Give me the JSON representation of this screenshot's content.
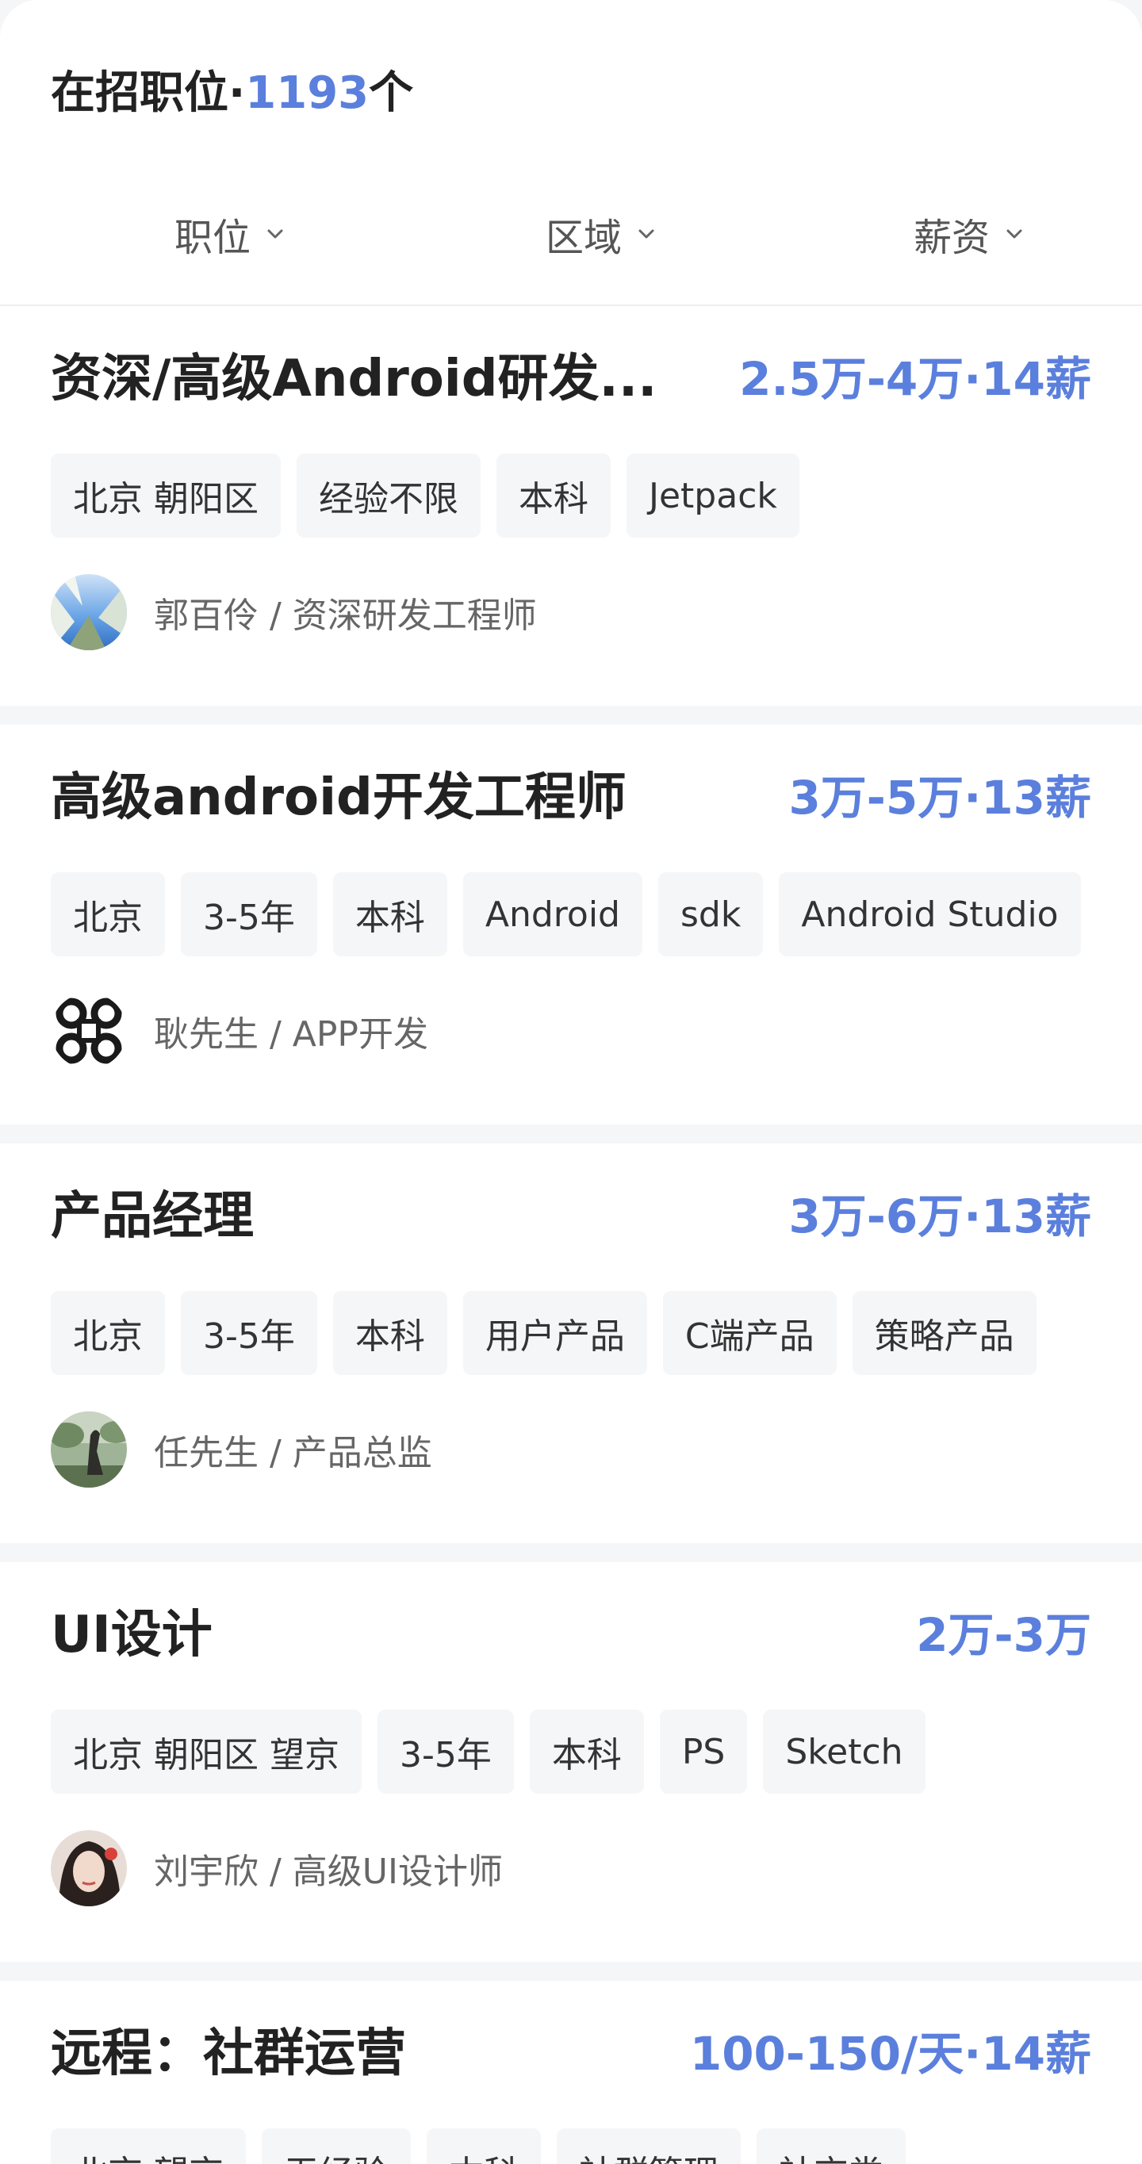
{
  "header": {
    "title_prefix": "在招职位·",
    "count": "1193",
    "title_suffix": "个"
  },
  "filters": [
    {
      "label": "职位",
      "icon": "chevron-down-icon"
    },
    {
      "label": "区域",
      "icon": "chevron-down-icon"
    },
    {
      "label": "薪资",
      "icon": "chevron-down-icon"
    }
  ],
  "jobs": [
    {
      "title": "资深/高级Android研发...",
      "salary": "2.5万-4万·14薪",
      "tags": [
        "北京 朝阳区",
        "经验不限",
        "本科",
        "Jetpack"
      ],
      "recruiter": "郭百伶 / 资深研发工程师",
      "avatar": "sky-photo-avatar"
    },
    {
      "title": "高级android开发工程师",
      "salary": "3万-5万·13薪",
      "tags": [
        "北京",
        "3-5年",
        "本科",
        "Android",
        "sdk",
        "Android Studio"
      ],
      "recruiter": "耿先生 / APP开发",
      "avatar": "knot-logo-avatar"
    },
    {
      "title": "产品经理",
      "salary": "3万-6万·13薪",
      "tags": [
        "北京",
        "3-5年",
        "本科",
        "用户产品",
        "C端产品",
        "策略产品"
      ],
      "recruiter": "任先生 / 产品总监",
      "avatar": "sculpture-photo-avatar"
    },
    {
      "title": "UI设计",
      "salary": "2万-3万",
      "tags": [
        "北京 朝阳区 望京",
        "3-5年",
        "本科",
        "PS",
        "Sketch"
      ],
      "recruiter": "刘宇欣 / 高级UI设计师",
      "avatar": "portrait-photo-avatar"
    },
    {
      "title": "远程：社群运营",
      "salary": "100-150/天·14薪",
      "tags": [
        "北京 望京",
        "无经验",
        "本科",
        "社群管理",
        "社交类"
      ],
      "recruiter": "",
      "avatar": ""
    }
  ],
  "colors": {
    "accent": "#5b7fdc",
    "tag_bg": "#f5f6f8",
    "page_bg": "#f5f6f8"
  }
}
